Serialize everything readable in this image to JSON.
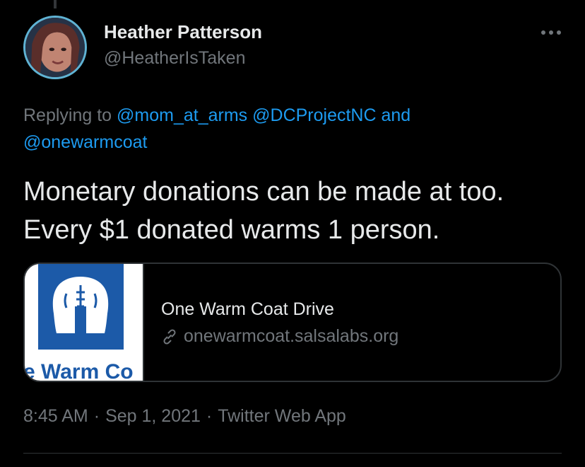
{
  "author": {
    "display_name": "Heather Patterson",
    "handle": "@HeatherIsTaken"
  },
  "reply": {
    "prefix": "Replying to",
    "mentions": [
      "@mom_at_arms",
      "@DCProjectNC",
      "@onewarmcoat"
    ],
    "conjunction": "and"
  },
  "tweet": {
    "text": "Monetary donations can be made at too. Every $1 donated warms 1 person."
  },
  "card": {
    "title": "One Warm Coat Drive",
    "url": "onewarmcoat.salsalabs.org",
    "thumb_text": "e Warm Co"
  },
  "meta": {
    "time": "8:45 AM",
    "date": "Sep 1, 2021",
    "source": "Twitter Web App",
    "separator": "·"
  },
  "icons": {
    "more": "more-icon",
    "link": "link-icon"
  },
  "colors": {
    "background": "#000000",
    "text": "#e7e9ea",
    "secondary": "#71767b",
    "accent": "#1d9bf0",
    "border": "#2f3336",
    "logo_blue": "#1c5aa8"
  }
}
